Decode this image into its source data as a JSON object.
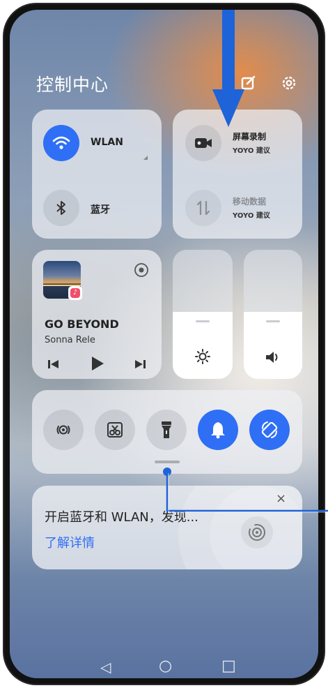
{
  "header": {
    "title": "控制中心",
    "edit_icon": "edit-icon",
    "settings_icon": "gear-icon"
  },
  "connectivity": {
    "wlan_label": "WLAN",
    "bluetooth_label": "蓝牙"
  },
  "suggestions": {
    "screen_record_label": "屏幕录制",
    "screen_record_sub": "YOYO 建议",
    "mobile_data_label": "移动数据",
    "mobile_data_sub": "YOYO 建议"
  },
  "media": {
    "song_title": "GO BEYOND",
    "artist": "Sonna Rele"
  },
  "sliders": {
    "brightness_level": 0.52,
    "volume_level": 0.52
  },
  "toolbar": {
    "items": [
      "nfc-icon",
      "screenshot-icon",
      "flashlight-icon",
      "bell-icon",
      "auto-rotate-icon"
    ]
  },
  "notice": {
    "text": "开启蓝牙和 WLAN，发现...",
    "link": "了解详情",
    "close": "×"
  },
  "nav": {
    "back": "◁",
    "home": "○",
    "recent": "□"
  },
  "colors": {
    "accent": "#2f6ff5",
    "annotation": "#1f63d8"
  }
}
